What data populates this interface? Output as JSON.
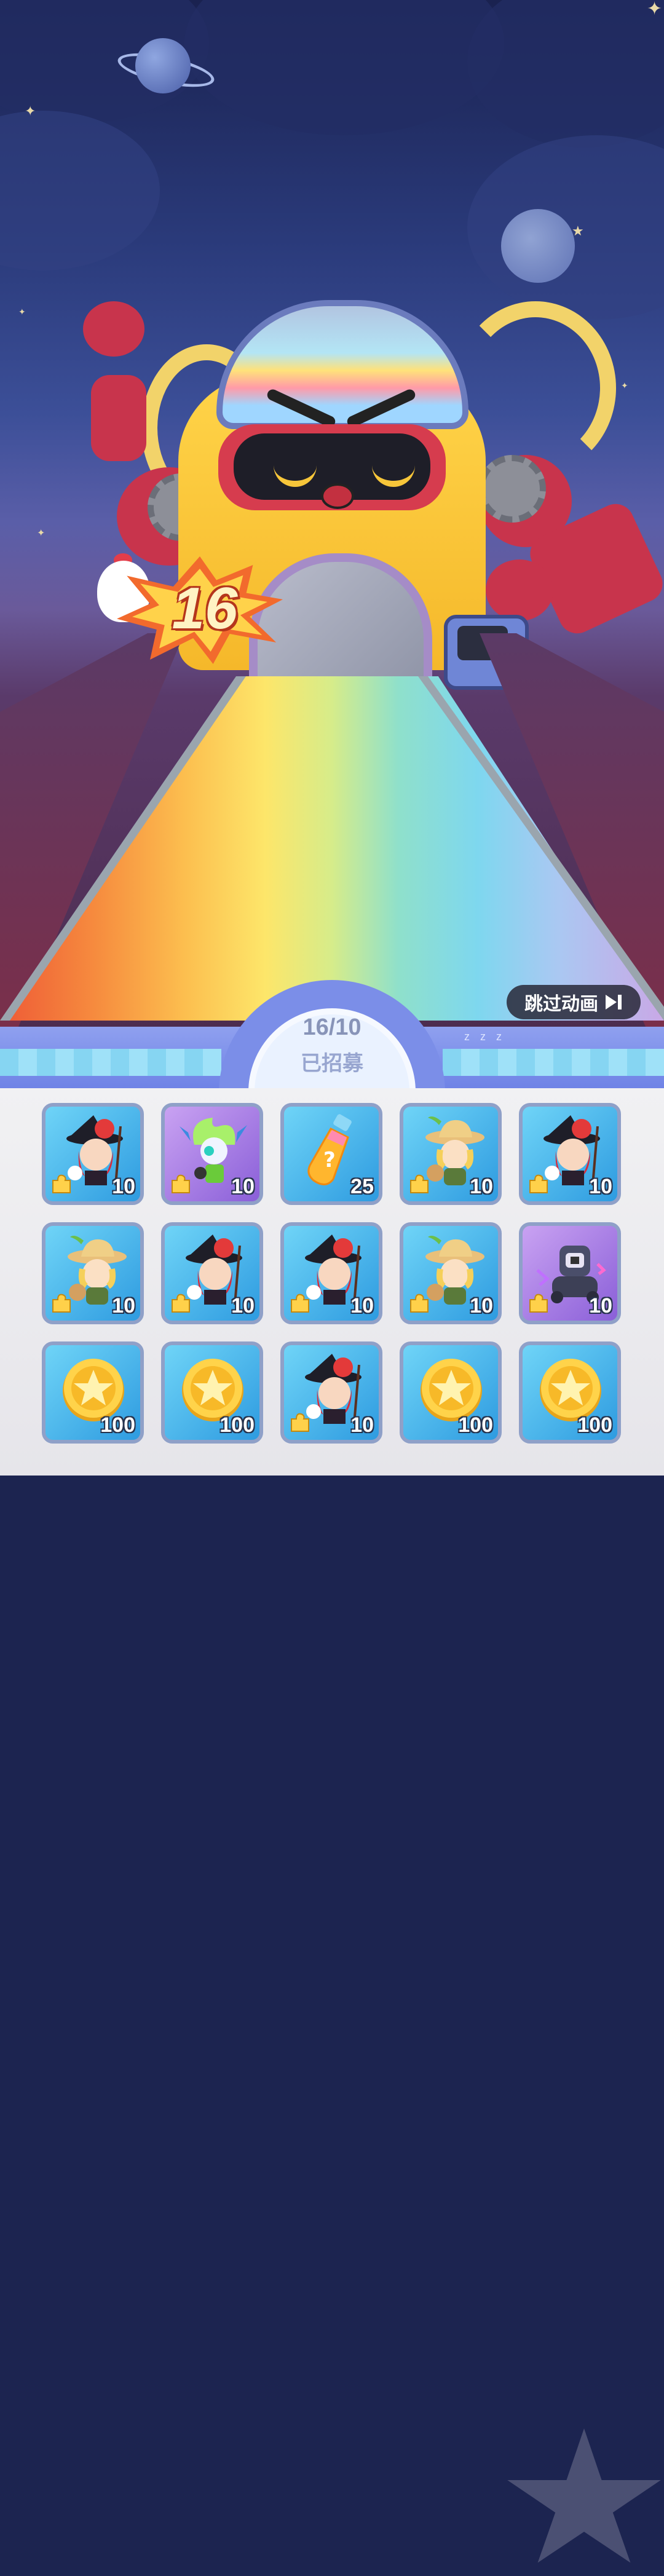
{
  "banner": {
    "count": "16"
  },
  "skip_button": {
    "label": "跳过动画"
  },
  "progress": {
    "text": "16/10",
    "label": "已招募",
    "sleep_text": "z z z"
  },
  "rewards": [
    {
      "type": "hero-red-witch",
      "frame": "blue",
      "quantity": "10"
    },
    {
      "type": "hero-green-spirit",
      "frame": "purple",
      "quantity": "10"
    },
    {
      "type": "potion-bottle",
      "frame": "blue",
      "quantity": "25"
    },
    {
      "type": "hero-yellow-hat",
      "frame": "blue",
      "quantity": "10"
    },
    {
      "type": "hero-red-witch",
      "frame": "blue",
      "quantity": "10"
    },
    {
      "type": "hero-yellow-hat",
      "frame": "blue",
      "quantity": "10"
    },
    {
      "type": "hero-red-witch",
      "frame": "blue",
      "quantity": "10"
    },
    {
      "type": "hero-red-witch",
      "frame": "blue",
      "quantity": "10"
    },
    {
      "type": "hero-yellow-hat",
      "frame": "blue",
      "quantity": "10"
    },
    {
      "type": "hero-robot",
      "frame": "purple",
      "quantity": "10"
    },
    {
      "type": "gold-coin",
      "frame": "blue",
      "quantity": "100"
    },
    {
      "type": "gold-coin",
      "frame": "blue",
      "quantity": "100"
    },
    {
      "type": "hero-red-witch",
      "frame": "blue",
      "quantity": "10"
    },
    {
      "type": "gold-coin",
      "frame": "blue",
      "quantity": "100"
    },
    {
      "type": "gold-coin",
      "frame": "blue",
      "quantity": "100"
    }
  ]
}
